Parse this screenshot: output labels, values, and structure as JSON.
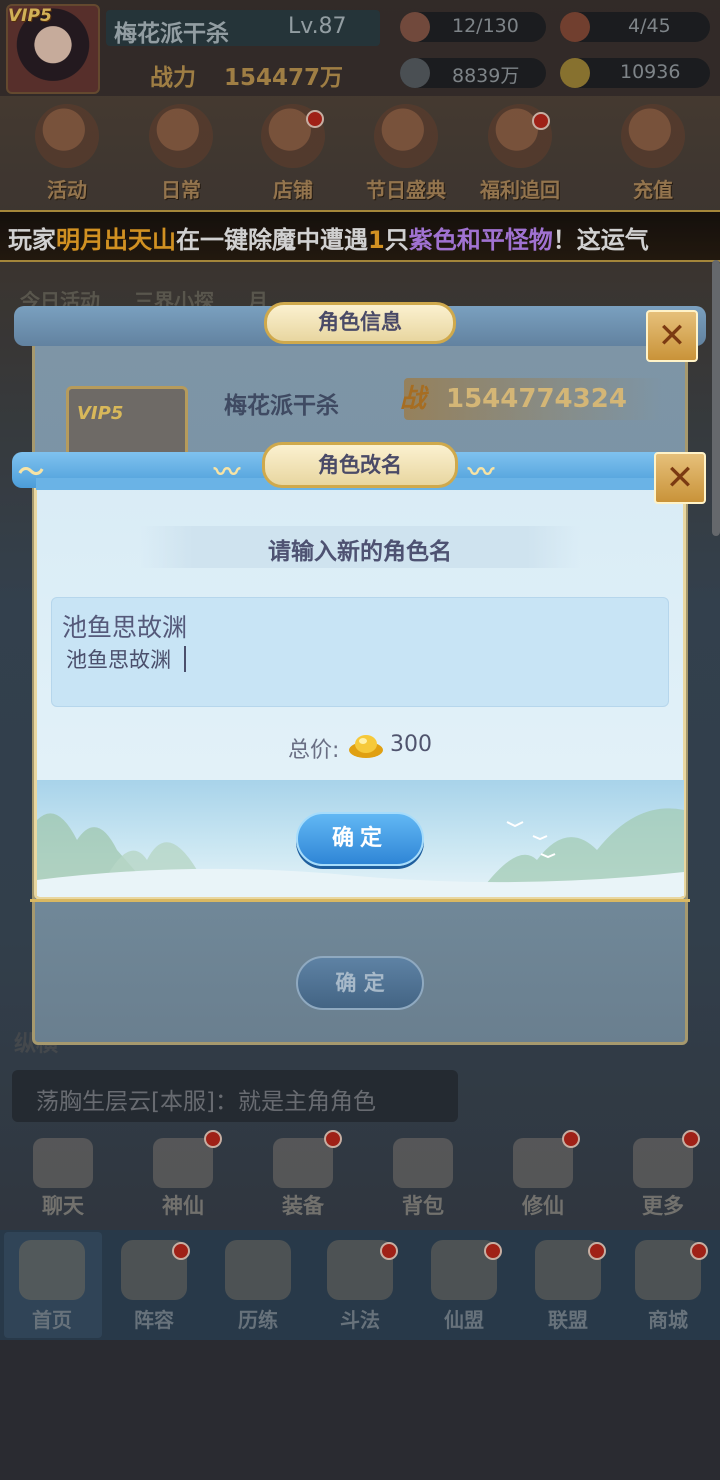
{
  "player": {
    "vip": "VIP5",
    "name": "梅花派干杀",
    "level": "Lv.87",
    "power_label": "战力",
    "power_value": "154477万"
  },
  "resources": {
    "stamina": "12/130",
    "fire": "4/45",
    "silver": "8839万",
    "gold": "10936"
  },
  "top_menu": [
    {
      "label": "活动"
    },
    {
      "label": "日常"
    },
    {
      "label": "店铺"
    },
    {
      "label": "节日盛典"
    },
    {
      "label": "福利追回"
    },
    {
      "label": "充值"
    }
  ],
  "marquee": {
    "p1": "玩家",
    "p2": "明月出天山",
    "p3": "在一键除魔中遭遇",
    "p4": "1",
    "p5": "只",
    "p6": "紫色和平怪物",
    "p7": "！这运气"
  },
  "second_row": [
    {
      "label": "今日活动"
    },
    {
      "label": "三界小探"
    },
    {
      "label": "月"
    }
  ],
  "role_info_panel": {
    "title": "角色信息",
    "vip": "VIP5",
    "name": "梅花派干杀",
    "power_icon": "战",
    "power": "1544774324",
    "confirm_label": "确 定"
  },
  "rename_dialog": {
    "title": "角色改名",
    "prompt": "请输入新的角色名",
    "current_name": "池鱼思故渊",
    "input_value": "池鱼思故渊",
    "price_label": "总价:",
    "price_value": "300",
    "confirm_label": "确定"
  },
  "chat": {
    "ally_label": "纵横",
    "message": "荡胸生层云[本服]：就是主角角色"
  },
  "functions": [
    {
      "label": "聊天"
    },
    {
      "label": "神仙"
    },
    {
      "label": "装备"
    },
    {
      "label": "背包"
    },
    {
      "label": "修仙"
    },
    {
      "label": "更多"
    }
  ],
  "nav": [
    {
      "label": "首页"
    },
    {
      "label": "阵容"
    },
    {
      "label": "历练"
    },
    {
      "label": "斗法"
    },
    {
      "label": "仙盟"
    },
    {
      "label": "联盟"
    },
    {
      "label": "商城"
    }
  ],
  "colors": {
    "dialog_header": "#4c9dd9",
    "confirm_button": "#2f86d6",
    "gold_text": "#ffb12a",
    "purple_text": "#c48bff",
    "alert_dot": "#c2291d"
  }
}
